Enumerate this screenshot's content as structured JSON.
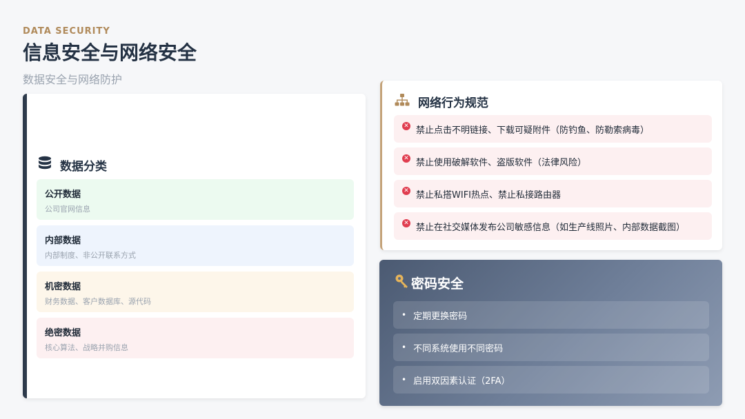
{
  "header": {
    "eyebrow": "DATA SECURITY",
    "title": "信息安全与网络安全",
    "subtitle": "数据安全与网络防护"
  },
  "data_classification": {
    "icon": "database-icon",
    "title": "数据分类",
    "items": [
      {
        "name": "公开数据",
        "desc": "公司官网信息",
        "color": "#ecfaf0"
      },
      {
        "name": "内部数据",
        "desc": "内部制度、非公开联系方式",
        "color": "#eef4fd"
      },
      {
        "name": "机密数据",
        "desc": "财务数据、客户数据库、源代码",
        "color": "#fdf6ea"
      },
      {
        "name": "绝密数据",
        "desc": "核心算法、战略并购信息",
        "color": "#fdf0f1"
      }
    ]
  },
  "network_rules": {
    "icon": "network-icon",
    "title": "网络行为规范",
    "items": [
      "禁止点击不明链接、下载可疑附件（防钓鱼、防勒索病毒）",
      "禁止使用破解软件、盗版软件（法律风险）",
      "禁止私搭WIFI热点、禁止私接路由器",
      "禁止在社交媒体发布公司敏感信息（如生产线照片、内部数据截图）"
    ]
  },
  "password_security": {
    "icon": "key-icon",
    "title": "密码安全",
    "items": [
      "定期更换密码",
      "不同系统使用不同密码",
      "启用双因素认证（2FA）"
    ]
  }
}
